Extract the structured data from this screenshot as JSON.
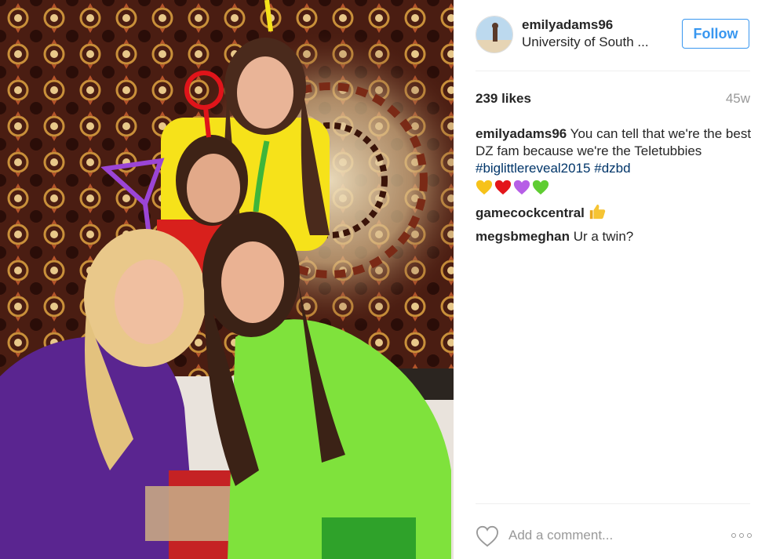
{
  "post": {
    "photo_description_icon": "group-photo",
    "author": {
      "username": "emilyadams96",
      "location": "University of South ...",
      "avatar_icon": "profile-avatar"
    },
    "follow_label": "Follow",
    "likes": "239 likes",
    "age": "45w",
    "caption": {
      "username": "emilyadams96",
      "text": "You can tell that we're the best DZ fam because we're the Teletubbies",
      "hashtags": [
        "#biglittlereveal2015",
        "#dzbd"
      ],
      "emoji": [
        "yellow-heart",
        "red-heart",
        "purple-heart",
        "green-heart"
      ]
    },
    "comments": [
      {
        "username": "gamecockcentral",
        "text": "",
        "emoji": "thumbs-up"
      },
      {
        "username": "megsbmeghan",
        "text": "Ur a twin?"
      }
    ],
    "comment_placeholder": "Add a comment...",
    "colors": {
      "accent": "#3897f0",
      "hashtag": "#003569",
      "muted": "#999999"
    }
  }
}
